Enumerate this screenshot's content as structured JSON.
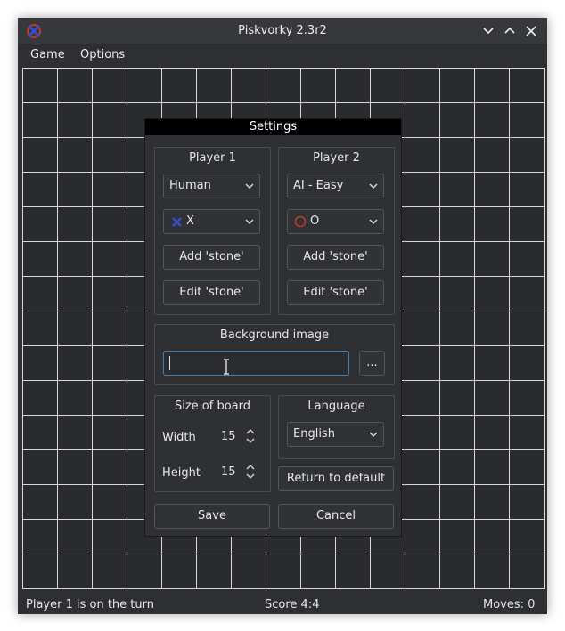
{
  "window": {
    "title": "Piskvorky 2.3r2"
  },
  "menu": {
    "items": [
      "Game",
      "Options"
    ]
  },
  "dialog": {
    "title": "Settings",
    "player1": {
      "title": "Player 1",
      "type": "Human",
      "stone": "X",
      "add_stone": "Add 'stone'",
      "edit_stone": "Edit 'stone'"
    },
    "player2": {
      "title": "Player 2",
      "type": "AI - Easy",
      "stone": "O",
      "add_stone": "Add 'stone'",
      "edit_stone": "Edit 'stone'"
    },
    "background": {
      "title": "Background image",
      "value": "",
      "browse": "..."
    },
    "board_size": {
      "title": "Size of board",
      "width_label": "Width",
      "width": "15",
      "height_label": "Height",
      "height": "15"
    },
    "language": {
      "title": "Language",
      "value": "English"
    },
    "return_default": "Return to default",
    "save": "Save",
    "cancel": "Cancel"
  },
  "status": {
    "turn": "Player 1 is on the turn",
    "score": "Score 4:4",
    "moves": "Moves: 0"
  },
  "colors": {
    "x_stone": "#3b4bd6",
    "o_stone": "#c0392b",
    "accent": "#3f7fb0"
  }
}
